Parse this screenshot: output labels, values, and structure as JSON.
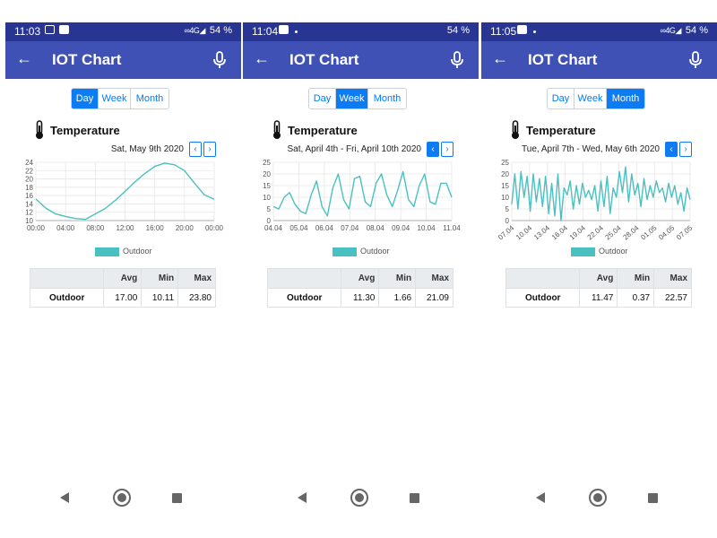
{
  "screens": [
    {
      "status_time": "11:03",
      "status_right": "54 %",
      "status_signal": "∞4G◢",
      "app_title": "IOT Chart",
      "tabs": [
        {
          "label": "Day",
          "active": true
        },
        {
          "label": "Week",
          "active": false
        },
        {
          "label": "Month",
          "active": false
        }
      ],
      "sensor_label": "Temperature",
      "date_range": "Sat, May 9th 2020",
      "prev_label": "‹",
      "next_label": "›",
      "legend_label": "Outdoor",
      "stats": {
        "headers": [
          "",
          "Avg",
          "Min",
          "Max"
        ],
        "row": [
          "Outdoor",
          "17.00",
          "10.11",
          "23.80"
        ]
      }
    },
    {
      "status_time": "11:04",
      "status_right": "54 %",
      "status_signal": "",
      "app_title": "IOT Chart",
      "tabs": [
        {
          "label": "Day",
          "active": false
        },
        {
          "label": "Week",
          "active": true
        },
        {
          "label": "Month",
          "active": false
        }
      ],
      "sensor_label": "Temperature",
      "date_range": "Sat, April 4th - Fri, April 10th 2020",
      "prev_label": "‹",
      "next_label": "›",
      "legend_label": "Outdoor",
      "stats": {
        "headers": [
          "",
          "Avg",
          "Min",
          "Max"
        ],
        "row": [
          "Outdoor",
          "11.30",
          "1.66",
          "21.09"
        ]
      }
    },
    {
      "status_time": "11:05",
      "status_right": "54 %",
      "status_signal": "∞4G◢",
      "app_title": "IOT Chart",
      "tabs": [
        {
          "label": "Day",
          "active": false
        },
        {
          "label": "Week",
          "active": false
        },
        {
          "label": "Month",
          "active": true
        }
      ],
      "sensor_label": "Temperature",
      "date_range": "Tue, April 7th - Wed, May 6th 2020",
      "prev_label": "‹",
      "next_label": "›",
      "legend_label": "Outdoor",
      "stats": {
        "headers": [
          "",
          "Avg",
          "Min",
          "Max"
        ],
        "row": [
          "Outdoor",
          "11.47",
          "0.37",
          "22.57"
        ]
      }
    }
  ],
  "colors": {
    "statusbar": "#283593",
    "appbar": "#3f51b5",
    "accent": "#0d7bf2",
    "series": "#4bc0c0"
  },
  "icons": {
    "back": "arrow-left-icon",
    "mic": "microphone-icon",
    "sensor": "thermometer-icon",
    "nav_back": "triangle-back-icon",
    "nav_home": "circle-home-icon",
    "nav_recent": "square-recent-icon"
  },
  "chart_data": [
    {
      "type": "line",
      "title": "",
      "x": [
        "00:00",
        "04:00",
        "08:00",
        "12:00",
        "16:00",
        "20:00",
        "00:00"
      ],
      "xlabel": "",
      "ylabel": "",
      "ylim": [
        10,
        24
      ],
      "yticks": [
        10,
        12,
        14,
        16,
        18,
        20,
        22,
        24
      ],
      "grid": true,
      "legend": "bottom",
      "series": [
        {
          "name": "Outdoor",
          "values": [
            15.2,
            13.0,
            11.6,
            11.0,
            10.5,
            10.3,
            11.6,
            12.9,
            14.8,
            17.0,
            19.3,
            21.3,
            23.0,
            23.8,
            23.4,
            22.0,
            19.0,
            16.2,
            15.1
          ]
        }
      ]
    },
    {
      "type": "line",
      "title": "",
      "x": [
        "04.04",
        "05.04",
        "06.04",
        "07.04",
        "08.04",
        "09.04",
        "10.04",
        "11.04"
      ],
      "xlabel": "",
      "ylabel": "",
      "ylim": [
        0,
        25
      ],
      "yticks": [
        0,
        5,
        10,
        15,
        20,
        25
      ],
      "grid": true,
      "legend": "bottom",
      "series": [
        {
          "name": "Outdoor",
          "values": [
            6,
            5,
            10,
            12,
            7,
            4,
            3,
            11,
            17,
            6,
            2,
            14,
            20,
            9,
            5,
            18,
            19,
            8,
            6,
            16,
            20,
            11,
            6,
            13,
            21,
            9,
            6,
            15,
            20,
            8,
            7,
            16,
            16,
            10
          ]
        }
      ]
    },
    {
      "type": "line",
      "title": "",
      "x": [
        "07.04",
        "10.04",
        "13.04",
        "16.04",
        "19.04",
        "22.04",
        "25.04",
        "28.04",
        "01.05",
        "04.05",
        "07.05"
      ],
      "xlabel": "",
      "ylabel": "",
      "ylim": [
        0,
        25
      ],
      "yticks": [
        0,
        5,
        10,
        15,
        20,
        25
      ],
      "grid": true,
      "legend": "bottom",
      "series": [
        {
          "name": "Outdoor",
          "values": [
            7,
            20,
            5,
            21,
            10,
            19,
            4,
            20,
            8,
            18,
            6,
            19,
            3,
            16,
            2,
            20,
            0,
            14,
            11,
            17,
            5,
            15,
            7,
            16,
            10,
            13,
            9,
            15,
            4,
            17,
            6,
            19,
            3,
            14,
            10,
            21,
            12,
            23,
            8,
            20,
            11,
            16,
            6,
            18,
            9,
            15,
            10,
            17,
            12,
            14,
            8,
            16,
            10,
            15,
            7,
            12,
            4,
            14,
            9
          ]
        }
      ]
    }
  ]
}
